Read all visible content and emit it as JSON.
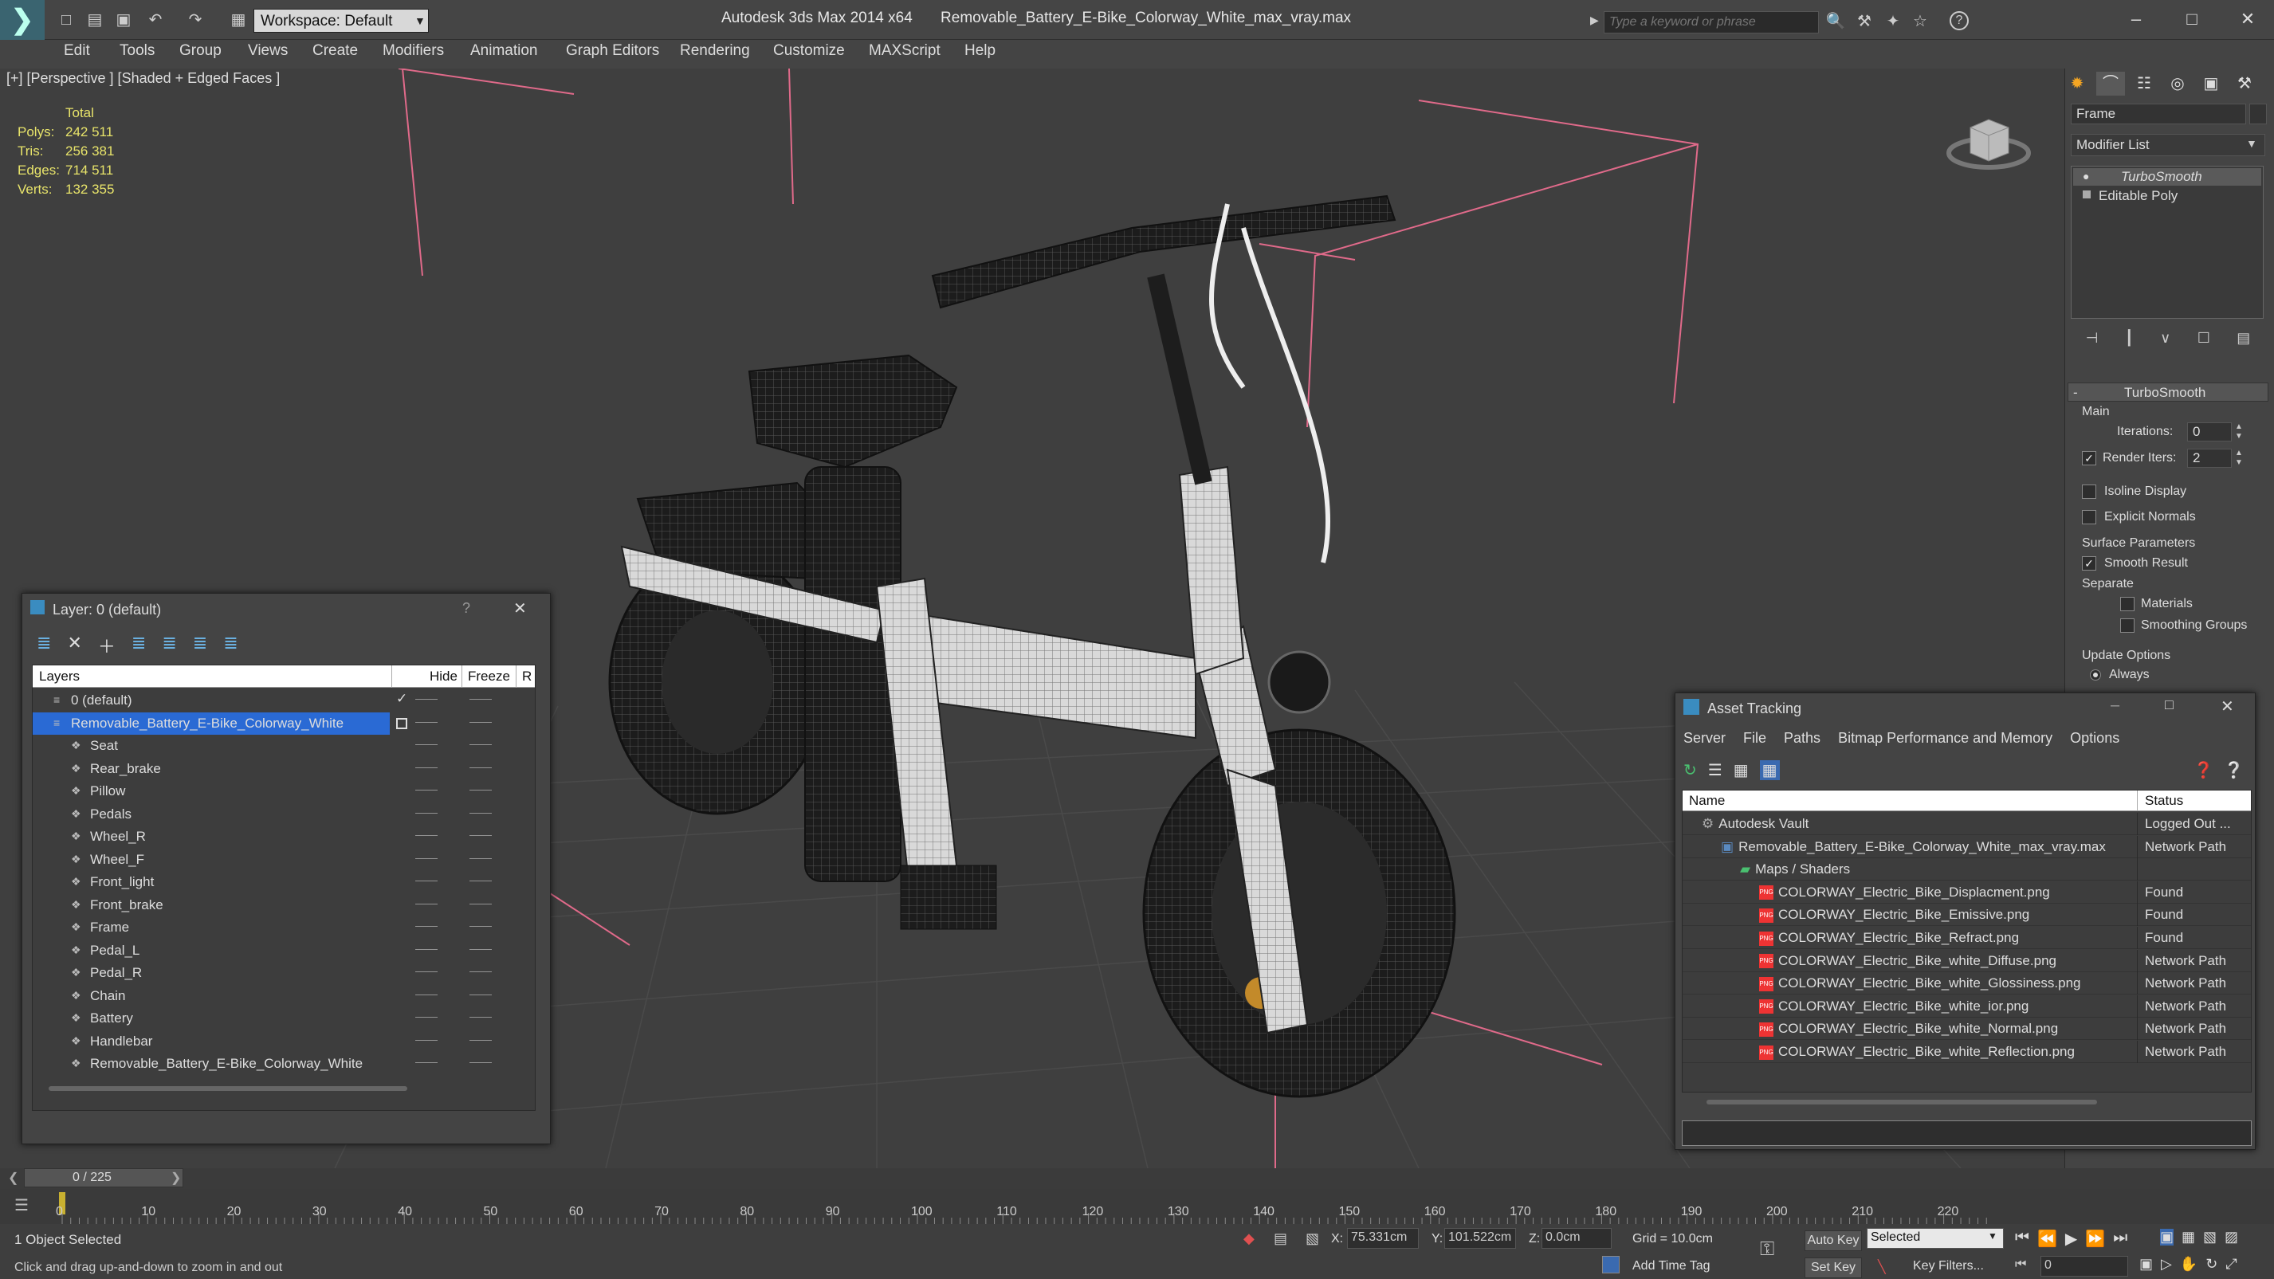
{
  "titlebar": {
    "workspace": "Workspace: Default",
    "app_name": "Autodesk 3ds Max  2014 x64",
    "file_name": "Removable_Battery_E-Bike_Colorway_White_max_vray.max",
    "search_placeholder": "Type a keyword or phrase"
  },
  "menu": [
    "Edit",
    "Tools",
    "Group",
    "Views",
    "Create",
    "Modifiers",
    "Animation",
    "Graph Editors",
    "Rendering",
    "Customize",
    "MAXScript",
    "Help"
  ],
  "viewport": {
    "label": "[+] [Perspective ] [Shaded + Edged Faces ]",
    "stats_header": "Total",
    "stats": [
      {
        "label": "Polys:",
        "value": "242 511"
      },
      {
        "label": "Tris:",
        "value": "256 381"
      },
      {
        "label": "Edges:",
        "value": "714 511"
      },
      {
        "label": "Verts:",
        "value": "132 355"
      }
    ]
  },
  "command_panel": {
    "object_name": "Frame",
    "modifier_list": "Modifier List",
    "stack": [
      "TurboSmooth",
      "Editable Poly"
    ],
    "rollout_title": "TurboSmooth",
    "main_label": "Main",
    "iterations_label": "Iterations:",
    "iterations_value": "0",
    "render_iters_label": "Render Iters:",
    "render_iters_value": "2",
    "isoline": "Isoline Display",
    "explicit_normals": "Explicit Normals",
    "surface_params": "Surface Parameters",
    "smooth_result": "Smooth Result",
    "separate": "Separate",
    "materials": "Materials",
    "smoothing_groups": "Smoothing Groups",
    "update_options": "Update Options",
    "always": "Always"
  },
  "layer_dialog": {
    "title": "Layer: 0 (default)",
    "help": "?",
    "col_layers": "Layers",
    "col_hide": "Hide",
    "col_freeze": "Freeze",
    "col_render": "R",
    "rows": [
      {
        "name": "0 (default)",
        "indent": 0
      },
      {
        "name": "Removable_Battery_E-Bike_Colorway_White",
        "indent": 0
      },
      {
        "name": "Seat",
        "indent": 1
      },
      {
        "name": "Rear_brake",
        "indent": 1
      },
      {
        "name": "Pillow",
        "indent": 1
      },
      {
        "name": "Pedals",
        "indent": 1
      },
      {
        "name": "Wheel_R",
        "indent": 1
      },
      {
        "name": "Wheel_F",
        "indent": 1
      },
      {
        "name": "Front_light",
        "indent": 1
      },
      {
        "name": "Front_brake",
        "indent": 1
      },
      {
        "name": "Frame",
        "indent": 1
      },
      {
        "name": "Pedal_L",
        "indent": 1
      },
      {
        "name": "Pedal_R",
        "indent": 1
      },
      {
        "name": "Chain",
        "indent": 1
      },
      {
        "name": "Battery",
        "indent": 1
      },
      {
        "name": "Handlebar",
        "indent": 1
      },
      {
        "name": "Removable_Battery_E-Bike_Colorway_White",
        "indent": 1
      }
    ]
  },
  "asset_dialog": {
    "title": "Asset Tracking",
    "menu": [
      "Server",
      "File",
      "Paths",
      "Bitmap Performance and Memory",
      "Options"
    ],
    "col_name": "Name",
    "col_status": "Status",
    "rows": [
      {
        "name": "Autodesk Vault",
        "status": "Logged Out ...",
        "indent": 1,
        "icon": "vault"
      },
      {
        "name": "Removable_Battery_E-Bike_Colorway_White_max_vray.max",
        "status": "Network Path",
        "indent": 2,
        "icon": "max"
      },
      {
        "name": "Maps / Shaders",
        "status": "",
        "indent": 3,
        "icon": "maps"
      },
      {
        "name": "COLORWAY_Electric_Bike_Displacment.png",
        "status": "Found",
        "indent": 4,
        "icon": "png"
      },
      {
        "name": "COLORWAY_Electric_Bike_Emissive.png",
        "status": "Found",
        "indent": 4,
        "icon": "png"
      },
      {
        "name": "COLORWAY_Electric_Bike_Refract.png",
        "status": "Found",
        "indent": 4,
        "icon": "png"
      },
      {
        "name": "COLORWAY_Electric_Bike_white_Diffuse.png",
        "status": "Network Path",
        "indent": 4,
        "icon": "png"
      },
      {
        "name": "COLORWAY_Electric_Bike_white_Glossiness.png",
        "status": "Network Path",
        "indent": 4,
        "icon": "png"
      },
      {
        "name": "COLORWAY_Electric_Bike_white_ior.png",
        "status": "Network Path",
        "indent": 4,
        "icon": "png"
      },
      {
        "name": "COLORWAY_Electric_Bike_white_Normal.png",
        "status": "Network Path",
        "indent": 4,
        "icon": "png"
      },
      {
        "name": "COLORWAY_Electric_Bike_white_Reflection.png",
        "status": "Network Path",
        "indent": 4,
        "icon": "png"
      }
    ]
  },
  "timeline": {
    "frame_counter": "0 / 225",
    "ticks": [
      "0",
      "10",
      "20",
      "30",
      "40",
      "50",
      "60",
      "70",
      "80",
      "90",
      "100",
      "110",
      "120",
      "130",
      "140",
      "150",
      "160",
      "170",
      "180",
      "190",
      "200",
      "210",
      "220"
    ]
  },
  "statusbar": {
    "selection": "1 Object Selected",
    "hint": "Click and drag up-and-down to zoom in and out",
    "x_label": "X:",
    "x_value": "75.331cm",
    "y_label": "Y:",
    "y_value": "101.522cm",
    "z_label": "Z:",
    "z_value": "0.0cm",
    "grid": "Grid = 10.0cm",
    "add_time_tag": "Add Time Tag",
    "auto_key": "Auto Key",
    "set_key": "Set Key",
    "selected": "Selected",
    "key_filters": "Key Filters...",
    "frame_field": "0"
  },
  "colors": {
    "selection_blue": "#2a6ad4",
    "stats_yellow": "#e7e36a",
    "bbox_pink": "#e06a8a"
  }
}
